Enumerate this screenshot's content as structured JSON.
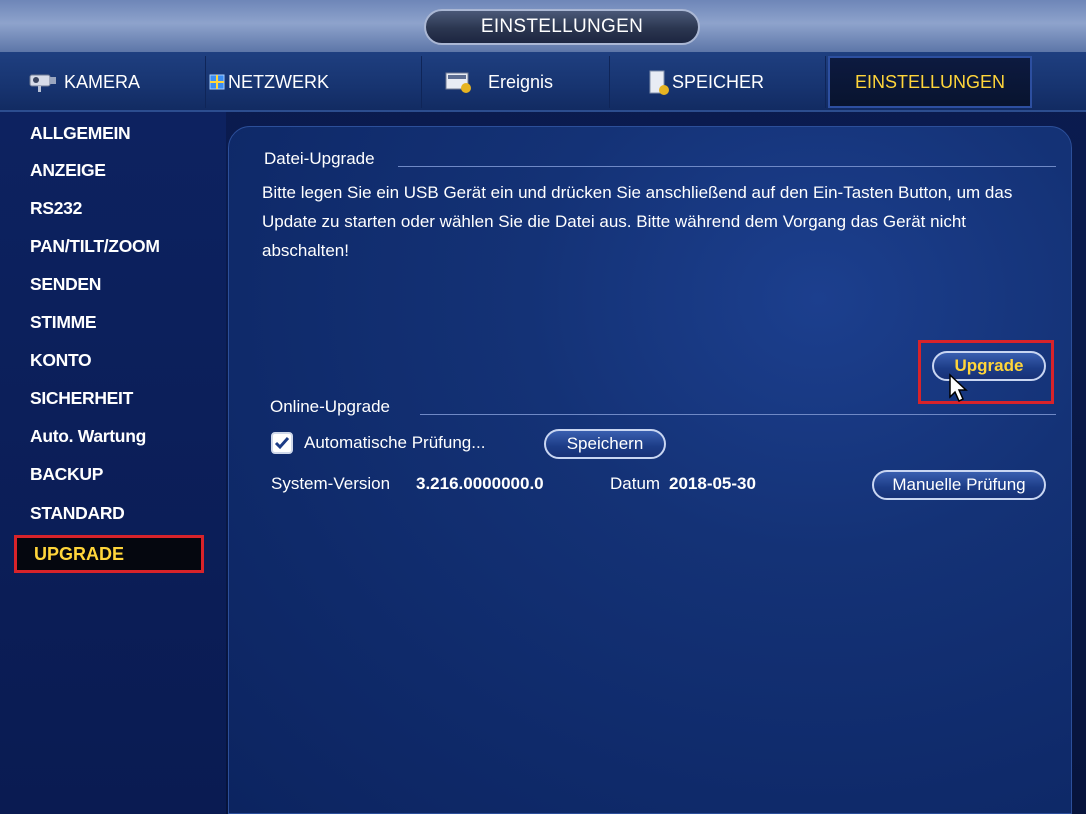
{
  "header": {
    "title": "EINSTELLUNGEN"
  },
  "tabs": [
    {
      "label": "KAMERA",
      "icon": "camera-icon"
    },
    {
      "label": "NETZWERK",
      "icon": "network-icon"
    },
    {
      "label": "Ereignis",
      "icon": "event-icon"
    },
    {
      "label": "SPEICHER",
      "icon": "storage-icon"
    },
    {
      "label": "EINSTELLUNGEN",
      "icon": "settings-icon",
      "active": true
    }
  ],
  "sidebar": {
    "items": [
      {
        "label": "ALLGEMEIN"
      },
      {
        "label": "ANZEIGE"
      },
      {
        "label": "RS232"
      },
      {
        "label": "PAN/TILT/ZOOM"
      },
      {
        "label": "SENDEN"
      },
      {
        "label": "STIMME"
      },
      {
        "label": "KONTO"
      },
      {
        "label": "SICHERHEIT"
      },
      {
        "label": "Auto. Wartung"
      },
      {
        "label": "BACKUP"
      },
      {
        "label": "STANDARD"
      },
      {
        "label": "UPGRADE",
        "active": true
      }
    ]
  },
  "file_upgrade": {
    "section_title": "Datei-Upgrade",
    "description": "Bitte legen Sie ein USB Gerät ein und drücken Sie anschließend auf den Ein-Tasten Button, um das Update zu starten oder wählen Sie die Datei aus. Bitte während dem Vorgang das Gerät nicht abschalten!",
    "upgrade_button": "Upgrade"
  },
  "online_upgrade": {
    "section_title": "Online-Upgrade",
    "auto_check_label": "Automatische Prüfung...",
    "auto_check_checked": true,
    "save_button": "Speichern",
    "system_version_label": "System-Version",
    "system_version_value": "3.216.0000000.0",
    "date_label": "Datum",
    "date_value": "2018-05-30",
    "manual_check_button": "Manuelle Prüfung"
  },
  "colors": {
    "accent_yellow": "#ffd53a",
    "highlight_red": "#d8232a",
    "panel_blue": "#143276"
  }
}
